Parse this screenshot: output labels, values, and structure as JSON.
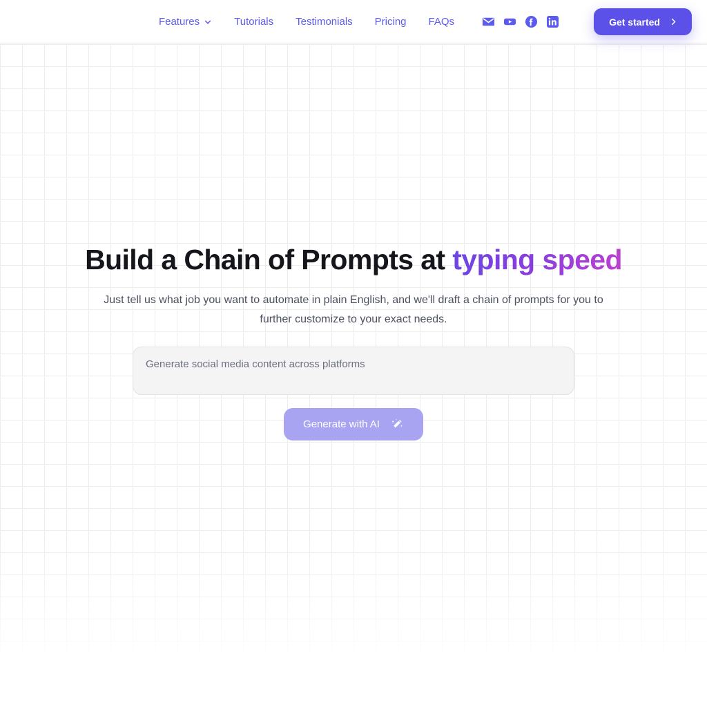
{
  "header": {
    "nav_items": [
      {
        "label": "Features",
        "icon": "chevron-down-icon",
        "has_dropdown": true
      },
      {
        "label": "Tutorials",
        "has_dropdown": false
      },
      {
        "label": "Testimonials",
        "has_dropdown": false
      },
      {
        "label": "Pricing",
        "has_dropdown": false
      },
      {
        "label": "FAQs",
        "has_dropdown": false
      }
    ],
    "socials": [
      {
        "name": "email-icon",
        "label": "Email"
      },
      {
        "name": "youtube-icon",
        "label": "YouTube"
      },
      {
        "name": "facebook-icon",
        "label": "Facebook"
      },
      {
        "name": "linkedin-icon",
        "label": "LinkedIn"
      }
    ],
    "cta_label": "Get started",
    "cta_icon": "chevron-right-icon"
  },
  "hero": {
    "title_main": "Build a Chain of Prompts at ",
    "title_accent": "typing speed",
    "subtitle": "Just tell us what job you want to automate in plain English, and we'll draft a chain of prompts for you to further customize to your exact needs.",
    "prompt_placeholder": "Generate social media content across platforms",
    "prompt_value": "",
    "generate_label": "Generate with AI",
    "generate_icon": "magic-wand-icon"
  },
  "colors": {
    "nav_link": "#5b5bef",
    "cta_bg": "#5b51e8",
    "generate_bg": "#a9a4f1",
    "accent_gradient_start": "#6b46e2",
    "accent_gradient_end": "#bd3fd0",
    "heading": "#15161c",
    "subtitle": "#4c5160",
    "grid_line": "#ececed"
  }
}
